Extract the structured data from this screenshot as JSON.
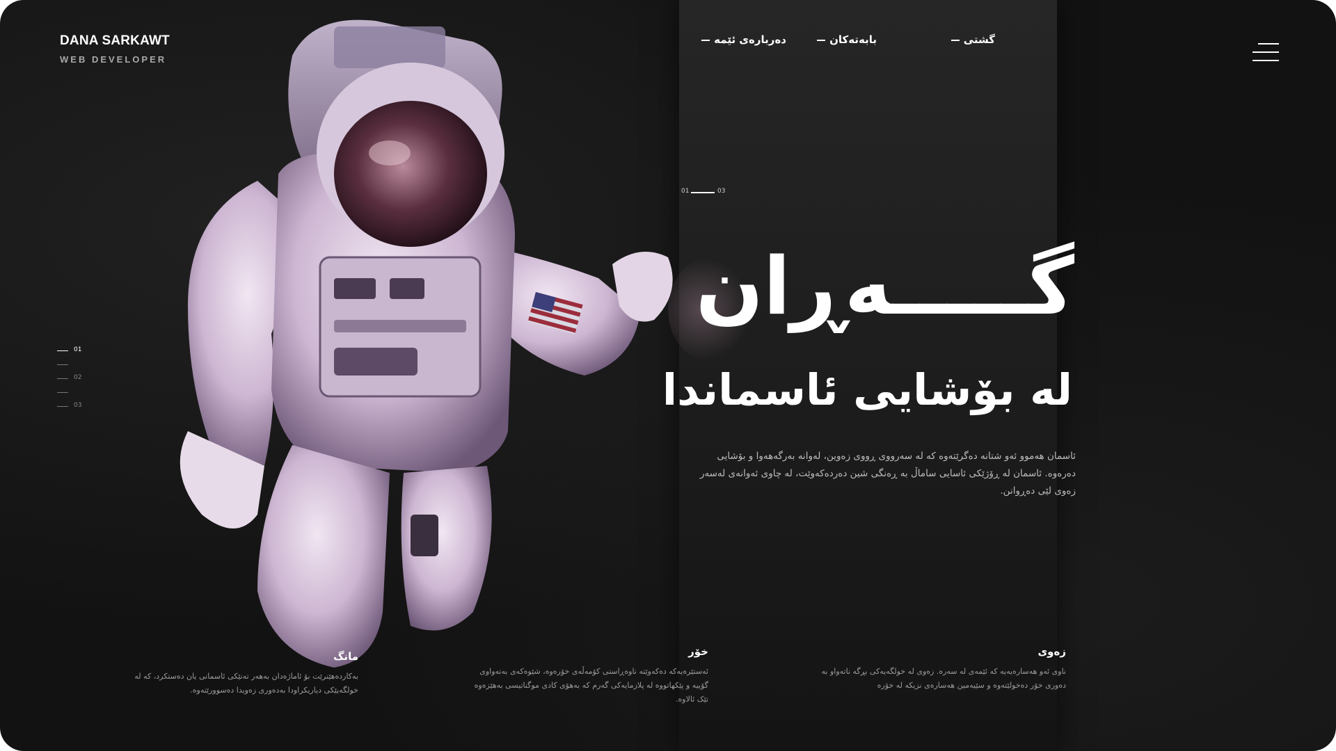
{
  "brand": {
    "name": "DANA SARKAWT",
    "role": "WEB DEVELOPER"
  },
  "nav": {
    "items": [
      "گشتی",
      "بابەتەکان",
      "دەربارەی ئێمە"
    ]
  },
  "menu_icon": "hamburger-menu-icon",
  "slide_counter": {
    "current": "01",
    "total": "03"
  },
  "side_pager": [
    "01",
    "02",
    "03"
  ],
  "hero": {
    "title": "گـــــەڕان",
    "subtitle": "لە بۆشایی ئاسماندا",
    "description": "ئاسمان هەموو ئەو شتانە دەگرێتەوە کە لە سەرووی ڕووی زەوین، لەوانە بەرگەهەوا و بۆشایی دەرەوە. ئاسمان لە ڕۆژێکی ئاسایی ساماڵ بە ڕەنگی شین دەردەکەوێت، لە چاوی ئەوانەی لەسەر زەوی لێی دەڕوانن."
  },
  "cards": [
    {
      "title": "مانگ",
      "text": "بەکاردەهێنرێت بۆ ئاماژەدان بەهەر تەنێکی ئاسمانی یان دەستکرد، کە لە خولگەیێکی دیاریکراودا بەدەوری زەویدا دەسوورێتەوە."
    },
    {
      "title": "خۆر",
      "text": "ئەستێرەیەکە دەکەوێتە ناوەڕاستی کۆمەڵەی خۆرەوە، شێوەکەی بەتەواوی گۆییە و پێکهاتووە لە پلازمایەکی گەرم کە بەهۆی کادی موگناتیسی بەهێزەوە تێک ئالاوە."
    },
    {
      "title": "زەوی",
      "text": "ناوی ئەو هەسارەیەیە کە ئێمەی لە سەرە. زەوی لە خولگەیەکی بڕگە ناتەواو بە دەوری خۆر دەخولێتەوە و سێیەمین هەسارەی نزیکە لە خۆرە"
    }
  ],
  "colors": {
    "background": "#121212",
    "panel": "#232323",
    "text": "#ffffff",
    "muted": "#bdbdbd",
    "suit": "#d9c4dd"
  }
}
